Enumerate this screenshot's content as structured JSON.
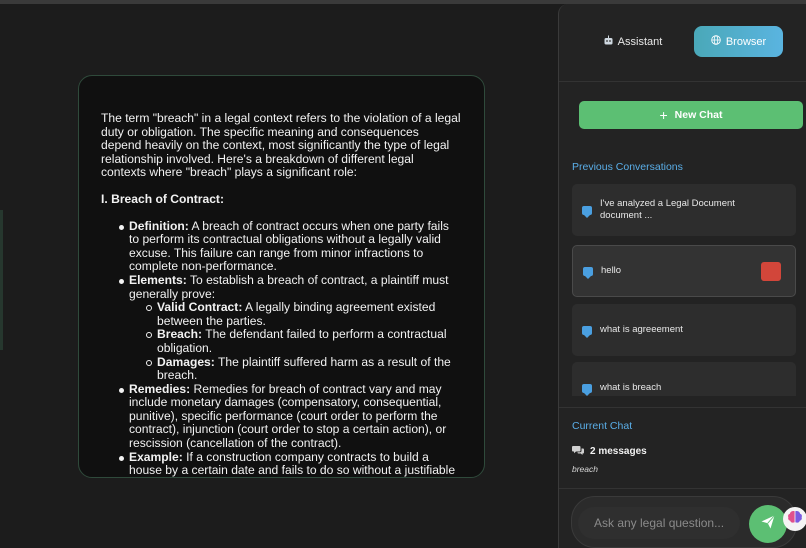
{
  "answer": {
    "intro": "The term \"breach\" in a legal context refers to the violation of a legal duty or obligation. The specific meaning and consequences depend heavily on the context, most significantly the type of legal relationship involved. Here's a breakdown of different legal contexts where \"breach\" plays a significant role:",
    "section_heading": "I. Breach of Contract:",
    "items": [
      {
        "term": "Definition:",
        "text": " A breach of contract occurs when one party fails to perform its contractual obligations without a legally valid excuse. This failure can range from minor infractions to complete non-performance."
      },
      {
        "term": "Elements:",
        "text": " To establish a breach of contract, a plaintiff must generally prove:"
      },
      {
        "term": "Remedies:",
        "text": " Remedies for breach of contract vary and may include monetary damages (compensatory, consequential, punitive), specific performance (court order to perform the contract), injunction (court order to stop a certain action), or rescission (cancellation of the contract)."
      },
      {
        "term": "Example:",
        "text": " If a construction company contracts to build a house by a certain date and fails to do so without a justifiable reason, this would be a breach of contract."
      }
    ],
    "sub_items": [
      {
        "term": "Valid Contract:",
        "text": " A legally binding agreement existed between the parties."
      },
      {
        "term": "Breach:",
        "text": " The defendant failed to perform a contractual obligation."
      },
      {
        "term": "Damages:",
        "text": " The plaintiff suffered harm as a result of the breach."
      }
    ]
  },
  "sidebar": {
    "tabs": [
      {
        "label": "Assistant",
        "icon": "robot-icon"
      },
      {
        "label": "Browser",
        "icon": "globe-icon"
      }
    ],
    "new_chat_label": "New Chat",
    "previous_title": "Previous Conversations",
    "conversations": [
      "I've analyzed a Legal Document document ...",
      "hello",
      "what is agreeement",
      "what is breach"
    ],
    "current_title": "Current Chat",
    "current_count": "2 messages",
    "current_subtitle": "breach",
    "input_placeholder": "Ask any legal question...",
    "colors": {
      "accent_green": "#5cbf73",
      "accent_blue": "#5aaee8",
      "danger": "#d2463a"
    }
  }
}
